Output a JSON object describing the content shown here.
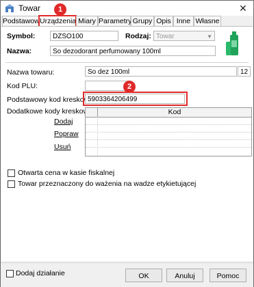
{
  "window": {
    "title": "Towar",
    "close": "✕"
  },
  "tabs": [
    {
      "label": "Podstawowe"
    },
    {
      "label": "Urządzenia"
    },
    {
      "label": "Miary"
    },
    {
      "label": "Parametry"
    },
    {
      "label": "Grupy"
    },
    {
      "label": "Opis"
    },
    {
      "label": "Inne"
    },
    {
      "label": "Własne"
    }
  ],
  "header": {
    "symbol_label": "Symbol:",
    "symbol_value": "DZSO100",
    "rodzaj_label": "Rodzaj:",
    "rodzaj_value": "Towar",
    "nazwa_label": "Nazwa:",
    "nazwa_value": "So dezodorant perfumowany 100ml"
  },
  "form": {
    "nazwa_towaru_label": "Nazwa towaru:",
    "nazwa_towaru_value": "So dez 100ml",
    "nazwa_towaru_count": "12",
    "kod_plu_label": "Kod PLU:",
    "kod_plu_value": "",
    "kod_kreskowy_label": "Podstawowy kod kreskowy:",
    "kod_kreskowy_value": "5903364206499",
    "dodatkowe_label": "Dodatkowe kody kreskowe:",
    "grid_header": "Kod",
    "dodaj": "Dodaj",
    "popraw": "Popraw",
    "usun": "Usuń",
    "otwarta_cena": "Otwarta cena w kasie fiskalnej",
    "przeznaczony": "Towar przeznaczony do ważenia na wadze etykietującej"
  },
  "footer": {
    "dodaj_dzialanie": "Dodaj działanie",
    "ok": "OK",
    "anuluj": "Anuluj",
    "pomoc": "Pomoc"
  },
  "annotations": {
    "badge1": "1",
    "badge2": "2"
  },
  "colors": {
    "highlight": "#e02a2a",
    "product_green": "#1fa35a"
  }
}
